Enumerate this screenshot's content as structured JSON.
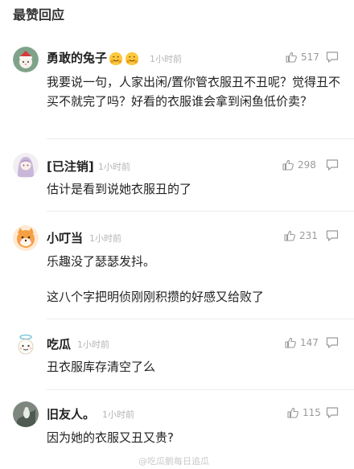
{
  "section": {
    "title": "最赞回应"
  },
  "comments": [
    {
      "username": "勇敢的兔子",
      "emojis": [
        "hugging-face-icon",
        "hugging-face-icon"
      ],
      "time": "1小时前",
      "likes": "517",
      "text": "我要说一句，人家出闲/置你管衣服丑不丑呢？觉得丑不买不就完了吗？好看的衣服谁会拿到闲鱼低价卖？"
    },
    {
      "username": "[已注销]",
      "time": "1小时前",
      "likes": "298",
      "text": "估计是看到说她衣服丑的了"
    },
    {
      "username": "小叮当",
      "time": "1小时前",
      "likes": "231",
      "text": "乐趣没了瑟瑟发抖。",
      "text2": "这八个字把明侦刚刚积攒的好感又给败了"
    },
    {
      "username": "吃瓜",
      "time": "1小时前",
      "likes": "147",
      "text": "丑衣服库存清空了么"
    },
    {
      "username": "旧友人。",
      "time": "1小时前",
      "likes": "115",
      "text": "因为她的衣服又丑又贵?"
    }
  ],
  "watermark": "@吃瓜鹅每日追瓜",
  "colors": {
    "text": "#222222",
    "meta": "#b5b5b5",
    "icon": "#9a9a9a",
    "divider": "#ececec"
  }
}
